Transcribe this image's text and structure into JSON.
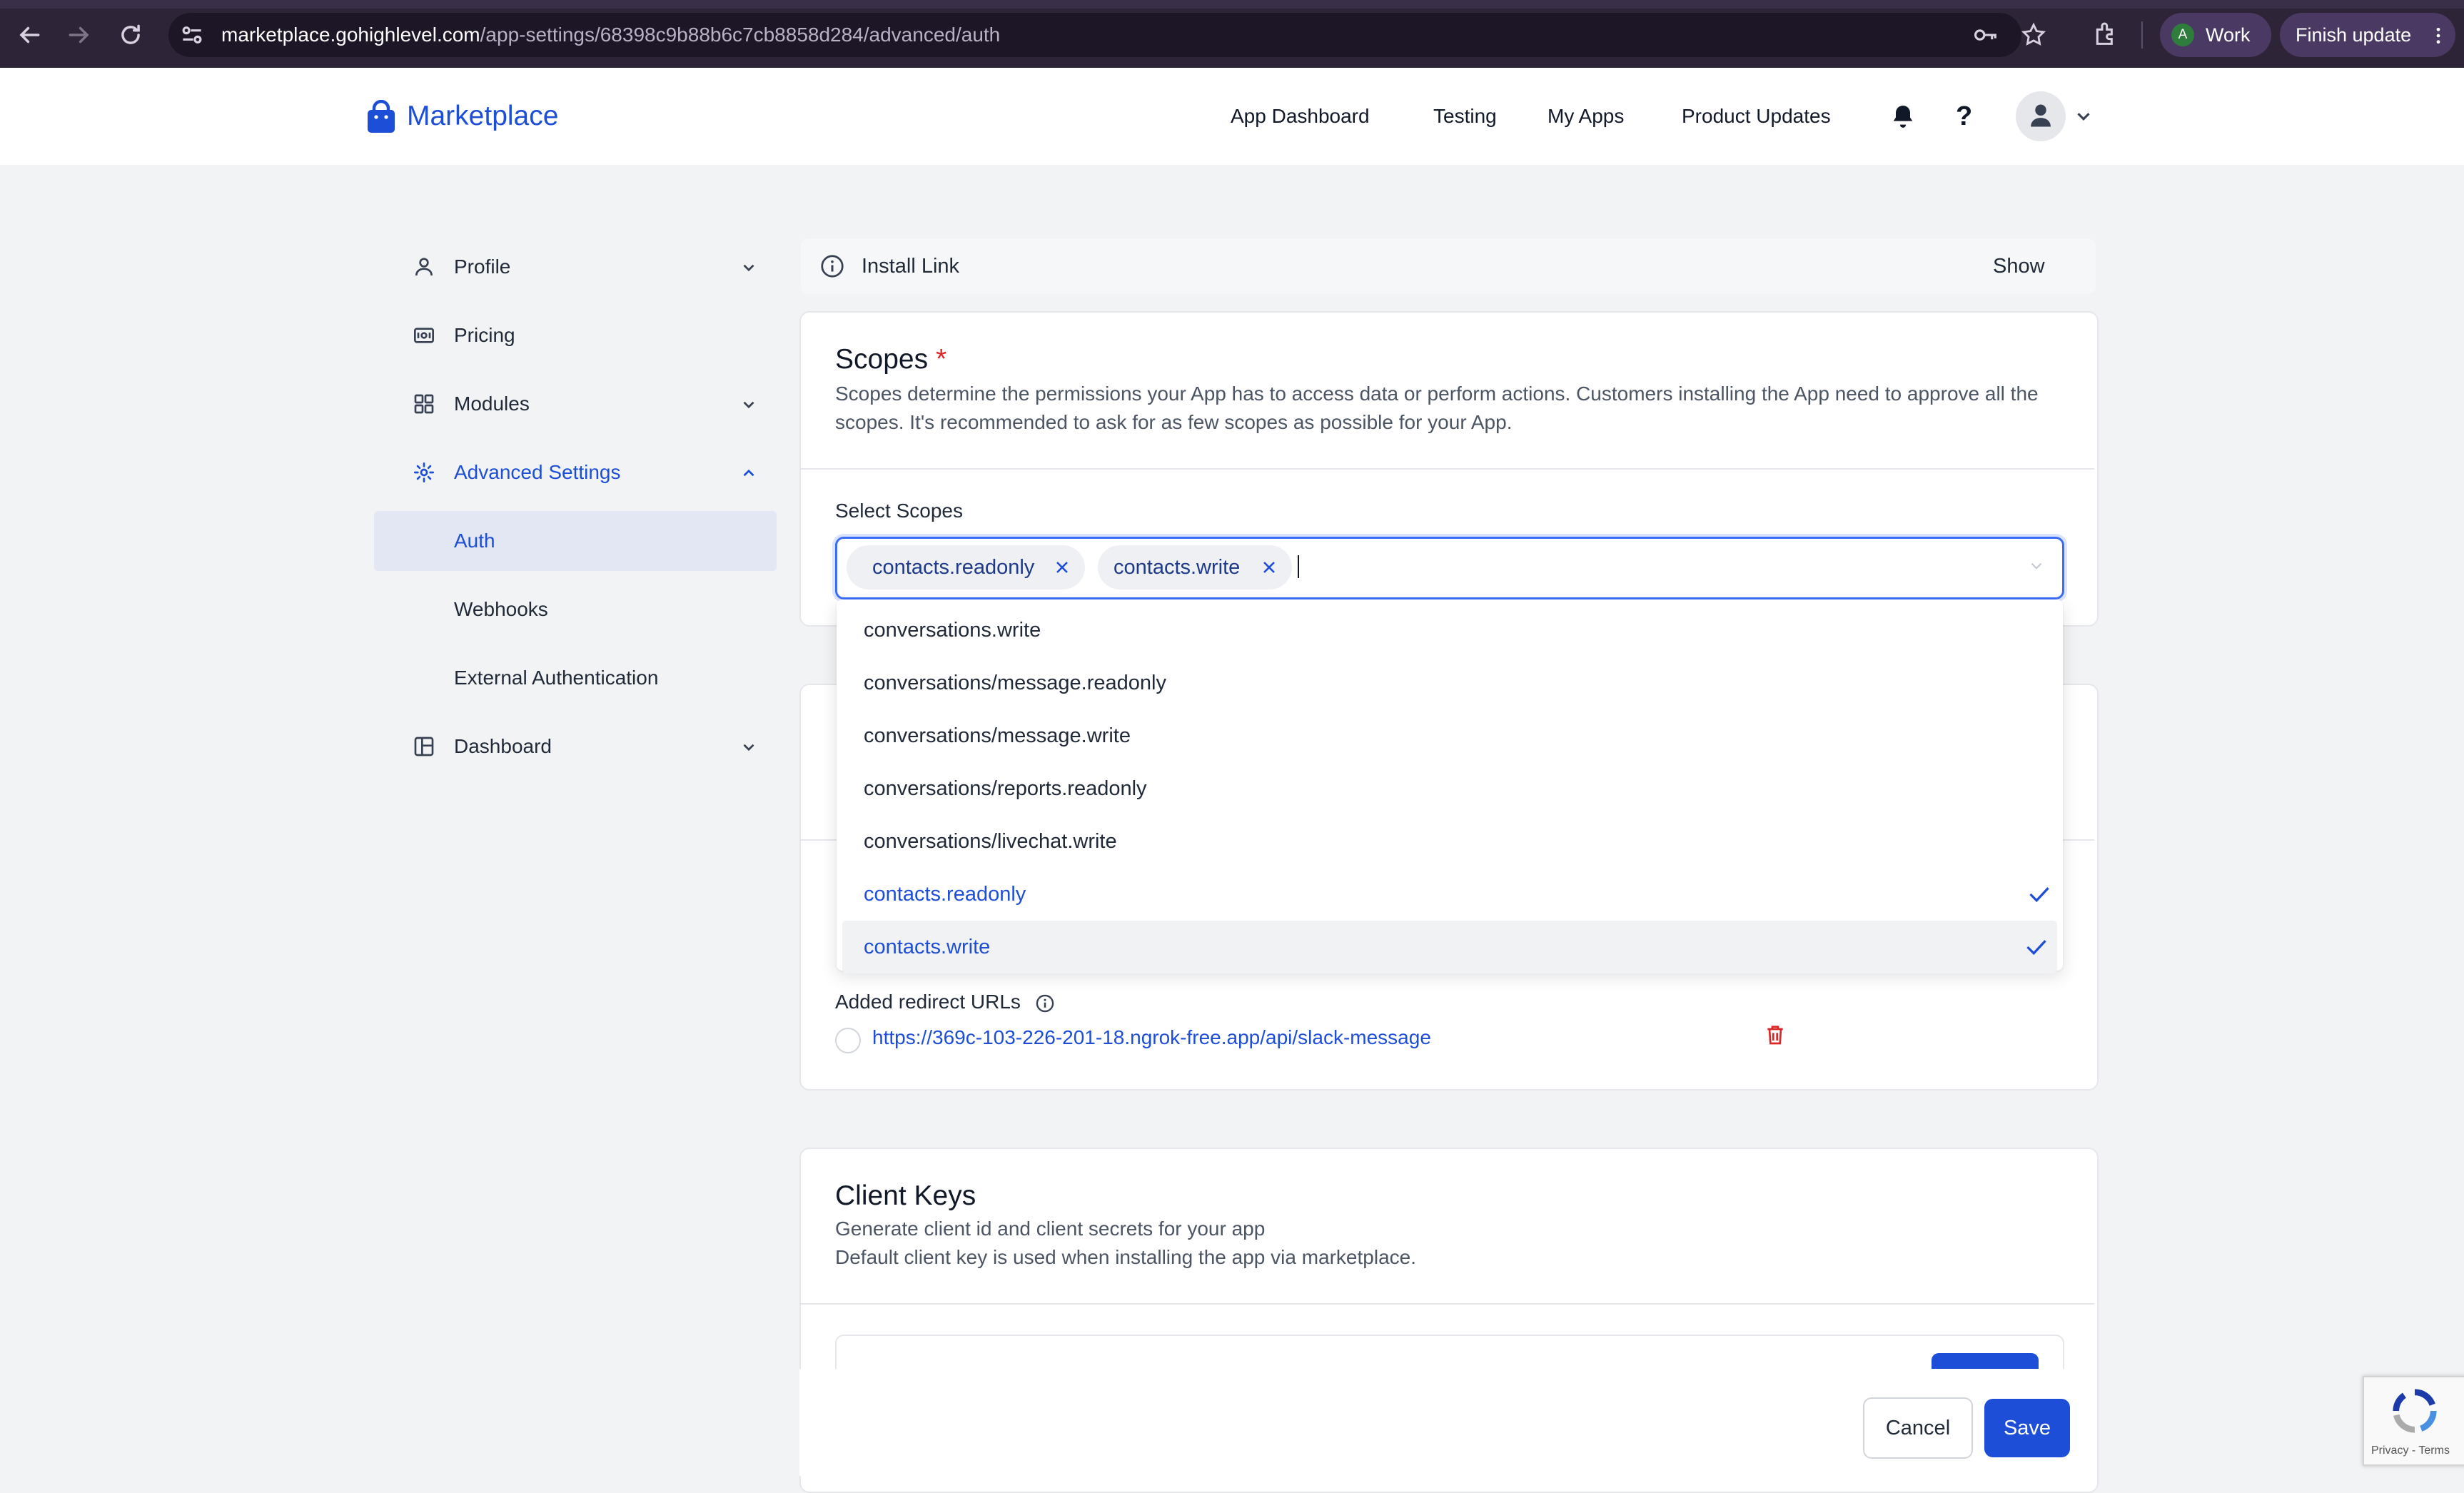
{
  "browser": {
    "url_host": "marketplace.gohighlevel.com",
    "url_path": "/app-settings/68398c9b88b6c7cb8858d284/advanced/auth",
    "profile_initial": "A",
    "profile_label": "Work",
    "update_label": "Finish update",
    "colors": {
      "frame": "#2d2438",
      "urlbar": "#1d1626",
      "pill": "#4a3a63"
    }
  },
  "header": {
    "brand": "Marketplace",
    "nav": [
      "App Dashboard",
      "Testing",
      "My Apps",
      "Product Updates"
    ],
    "help_glyph": "?",
    "brand_color": "#1d4ed8"
  },
  "sidebar": {
    "items": [
      {
        "label": "Profile",
        "icon": "user-icon",
        "expandable": true
      },
      {
        "label": "Pricing",
        "icon": "pricing-icon",
        "expandable": false
      },
      {
        "label": "Modules",
        "icon": "grid-icon",
        "expandable": true
      },
      {
        "label": "Advanced Settings",
        "icon": "gear-icon",
        "expandable": true,
        "expanded": true,
        "active": true
      },
      {
        "label": "Auth",
        "sub": true,
        "selected": true
      },
      {
        "label": "Webhooks",
        "sub": true
      },
      {
        "label": "External Authentication",
        "sub": true
      },
      {
        "label": "Dashboard",
        "icon": "dashboard-icon",
        "expandable": true
      }
    ]
  },
  "install_link": {
    "label": "Install Link",
    "action": "Show"
  },
  "scopes": {
    "title": "Scopes",
    "required_mark": "*",
    "description": "Scopes determine the permissions your App has to access data or perform actions. Customers installing the App need to approve all the scopes. It's recommended to ask for as few scopes as possible for your App.",
    "select_label": "Select Scopes",
    "selected": [
      "contacts.readonly",
      "contacts.write"
    ],
    "options": [
      {
        "label": "conversations.write",
        "selected": false
      },
      {
        "label": "conversations/message.readonly",
        "selected": false
      },
      {
        "label": "conversations/message.write",
        "selected": false
      },
      {
        "label": "conversations/reports.readonly",
        "selected": false
      },
      {
        "label": "conversations/livechat.write",
        "selected": false
      },
      {
        "label": "contacts.readonly",
        "selected": true
      },
      {
        "label": "contacts.write",
        "selected": true,
        "highlighted": true
      }
    ]
  },
  "redirects": {
    "label": "Added redirect URLs",
    "urls": [
      "https://369c-103-226-201-18.ngrok-free.app/api/slack-message"
    ]
  },
  "client_keys": {
    "title": "Client Keys",
    "line1": "Generate client id and client secrets for your app",
    "line2": "Default client key is used when installing the app via marketplace."
  },
  "footer": {
    "cancel": "Cancel",
    "save": "Save"
  },
  "recaptcha": {
    "privacy": "Privacy",
    "separator": " - ",
    "terms": "Terms"
  }
}
